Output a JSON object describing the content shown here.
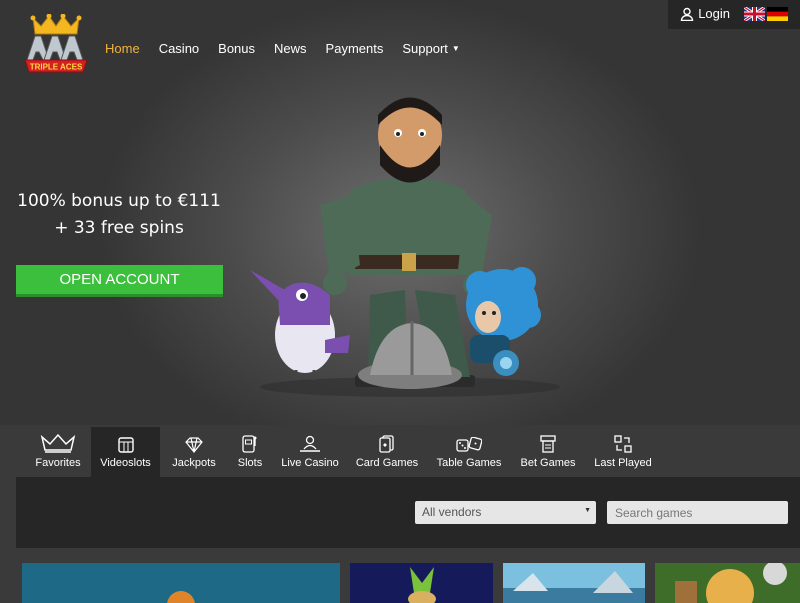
{
  "header": {
    "login_label": "Login",
    "flags": [
      "uk-flag",
      "germany-flag"
    ]
  },
  "logo": {
    "text": "TRIPLE ACES",
    "letters": "AAA"
  },
  "nav": {
    "items": [
      {
        "label": "Home",
        "active": true
      },
      {
        "label": "Casino"
      },
      {
        "label": "Bonus"
      },
      {
        "label": "News"
      },
      {
        "label": "Payments"
      },
      {
        "label": "Support",
        "dropdown": true
      }
    ]
  },
  "promo": {
    "line1": "100% bonus up to €111",
    "line2": "+ 33 free spins",
    "cta_label": "OPEN ACCOUNT"
  },
  "categories": [
    {
      "label": "Favorites",
      "icon": "crown-icon"
    },
    {
      "label": "Videoslots",
      "icon": "slot-machine-icon",
      "active": true
    },
    {
      "label": "Jackpots",
      "icon": "diamond-icon"
    },
    {
      "label": "Slots",
      "icon": "slot-icon"
    },
    {
      "label": "Live Casino",
      "icon": "live-dealer-icon"
    },
    {
      "label": "Card Games",
      "icon": "cards-icon"
    },
    {
      "label": "Table Games",
      "icon": "dice-icon"
    },
    {
      "label": "Bet Games",
      "icon": "bet-icon"
    },
    {
      "label": "Last Played",
      "icon": "history-icon"
    }
  ],
  "filters": {
    "vendor_selected": "All vendors",
    "search_placeholder": "Search games"
  },
  "colors": {
    "accent": "#f2b33d",
    "cta": "#3cbf3c",
    "panel": "#262626"
  }
}
